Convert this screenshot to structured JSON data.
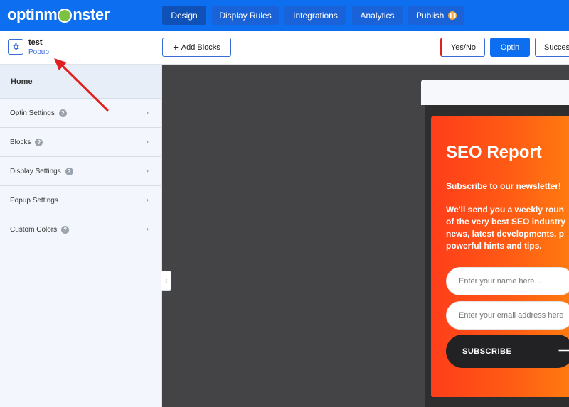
{
  "brand": {
    "logo_text_a": "optinm",
    "logo_text_b": "nster"
  },
  "nav": {
    "tabs": [
      {
        "label": "Design"
      },
      {
        "label": "Display Rules"
      },
      {
        "label": "Integrations"
      },
      {
        "label": "Analytics"
      },
      {
        "label": "Publish"
      }
    ]
  },
  "campaign": {
    "name": "test",
    "type": "Popup"
  },
  "toolbar": {
    "add_blocks_label": "Add Blocks",
    "views": [
      "Yes/No",
      "Optin",
      "Succes"
    ]
  },
  "sidebar": {
    "home": "Home",
    "items": [
      {
        "label": "Optin Settings",
        "has_help": true
      },
      {
        "label": "Blocks",
        "has_help": true
      },
      {
        "label": "Display Settings",
        "has_help": true
      },
      {
        "label": "Popup Settings",
        "has_help": false
      },
      {
        "label": "Custom Colors",
        "has_help": true
      }
    ]
  },
  "popup": {
    "title": "SEO Report",
    "subtitle": "Subscribe to our newsletter!",
    "body": "We'll send you a weekly roun\nof the very best SEO industry\nnews, latest developments, p\npowerful hints and tips.",
    "name_placeholder": "Enter your name here...",
    "email_placeholder": "Enter your email address here",
    "subscribe_label": "SUBSCRIBE"
  },
  "colors": {
    "brand_blue": "#0d6ef0",
    "popup_orange": "#ff5d14",
    "annotation_red": "#e02020"
  }
}
